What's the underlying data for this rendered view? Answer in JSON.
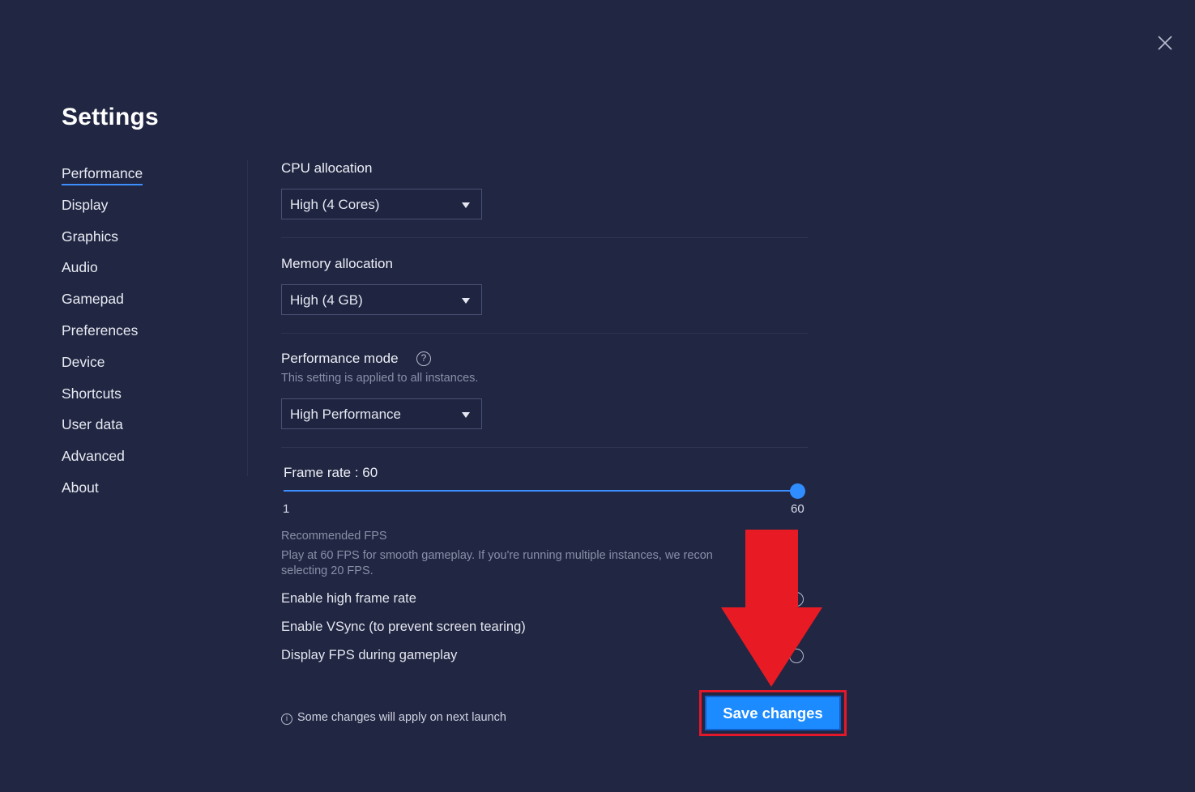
{
  "window": {
    "title": "Settings",
    "close_icon": "close-icon"
  },
  "sidebar": {
    "items": [
      {
        "label": "Performance",
        "active": true
      },
      {
        "label": "Display"
      },
      {
        "label": "Graphics"
      },
      {
        "label": "Audio"
      },
      {
        "label": "Gamepad"
      },
      {
        "label": "Preferences"
      },
      {
        "label": "Device"
      },
      {
        "label": "Shortcuts"
      },
      {
        "label": "User data"
      },
      {
        "label": "Advanced"
      },
      {
        "label": "About"
      }
    ],
    "accent_color": "#3d8eff"
  },
  "performance": {
    "cpu": {
      "label": "CPU allocation",
      "selected": "High (4 Cores)"
    },
    "memory": {
      "label": "Memory allocation",
      "selected": "High (4 GB)"
    },
    "mode": {
      "label": "Performance mode",
      "help_icon": "help-icon",
      "note": "This setting is applied to all instances.",
      "selected": "High Performance"
    },
    "frame_rate": {
      "label": "Frame rate : 60",
      "value": 60,
      "min_label": "1",
      "max_label": "60"
    },
    "recommended": {
      "title": "Recommended FPS",
      "text_line1": "Play at 60 FPS for smooth gameplay. If you're running multiple instances, we recon",
      "text_line2": "selecting 20 FPS."
    },
    "toggles": [
      {
        "label": "Enable high frame rate",
        "on": false
      },
      {
        "label": "Enable VSync (to prevent screen tearing)",
        "on": false
      },
      {
        "label": "Display FPS during gameplay",
        "on": false
      }
    ]
  },
  "footer": {
    "note": "Some changes will apply on next launch",
    "info_icon": "info-icon",
    "save_label": "Save changes"
  },
  "colors": {
    "background": "#212642",
    "primary_button": "#1c8bff",
    "annotation_red": "#e3182a"
  },
  "annotation": {
    "arrow_icon": "down-arrow-icon"
  }
}
